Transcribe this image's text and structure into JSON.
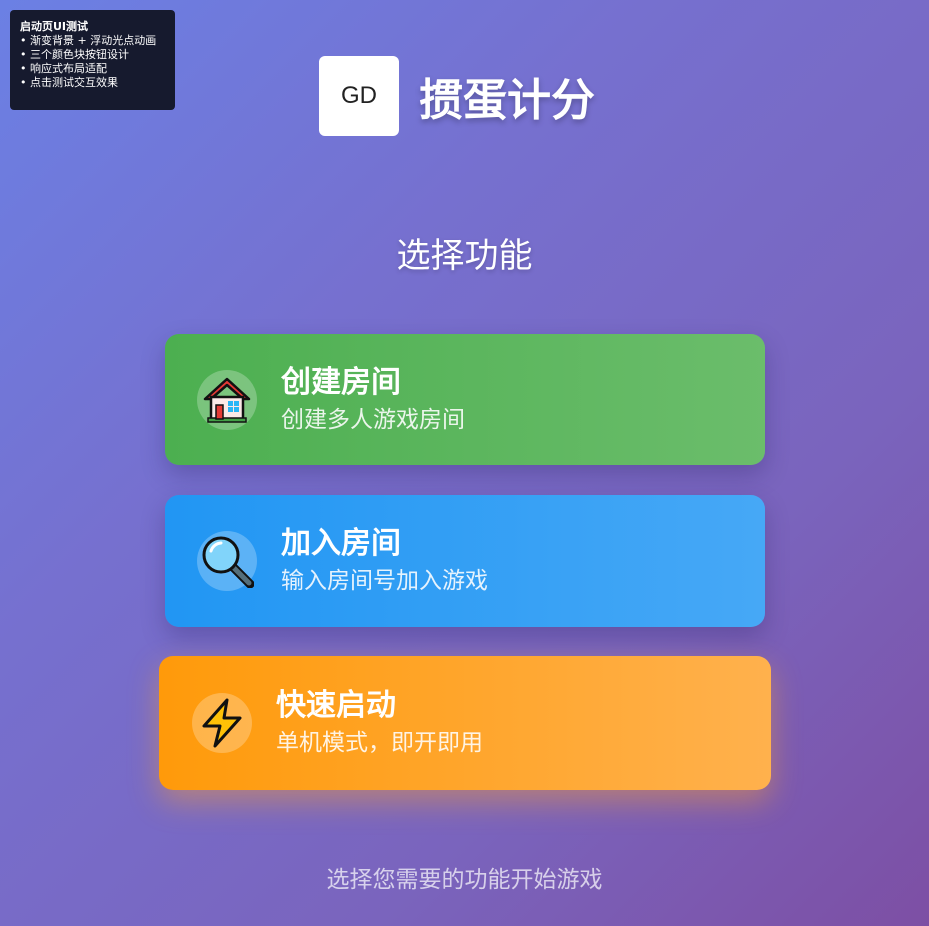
{
  "info": {
    "title": "启动页UI测试",
    "lines": [
      "• 渐变背景 + 浮动光点动画",
      "• 三个颜色块按钮设计",
      "• 响应式布局适配",
      "• 点击测试交互效果"
    ]
  },
  "header": {
    "logo_text": "GD",
    "title": "掼蛋计分"
  },
  "subtitle": "选择功能",
  "cards": [
    {
      "title": "创建房间",
      "desc": "创建多人游戏房间",
      "icon": "house-icon",
      "color": "#4caf50"
    },
    {
      "title": "加入房间",
      "desc": "输入房间号加入游戏",
      "icon": "magnifier-icon",
      "color": "#2196f3"
    },
    {
      "title": "快速启动",
      "desc": "单机模式，即开即用",
      "icon": "lightning-icon",
      "color": "#ff9a0a"
    }
  ],
  "footer": "选择您需要的功能开始游戏"
}
